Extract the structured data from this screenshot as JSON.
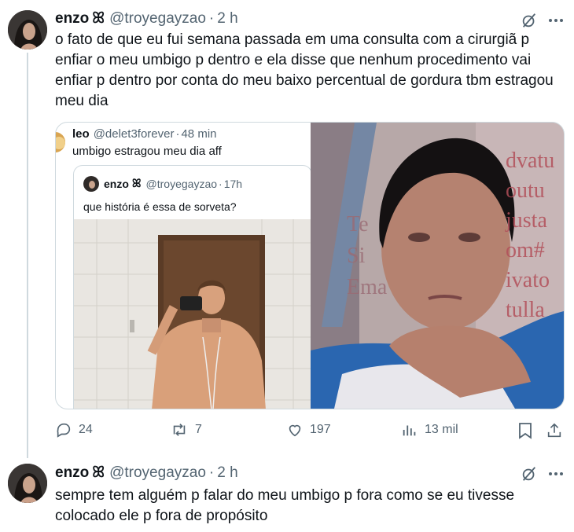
{
  "tweet1": {
    "display_name": "enzo",
    "badge": "ꕤ",
    "handle": "@troyegayzao",
    "sep": "·",
    "time": "2 h",
    "text_lines": [
      "o fato de que eu fui semana passada em uma consulta com a cirurgiã p",
      "enfiar o meu umbigo p dentro e ela disse que nenhum procedimento vai",
      "enfiar p dentro por conta do meu baixo percentual de gordura tbm estragou",
      "meu dia"
    ],
    "quote": {
      "display_name": "leo",
      "handle": "@delet3forever",
      "sep": "·",
      "time": "48 min",
      "text": "umbigo estragou meu dia aff",
      "inner": {
        "display_name": "enzo",
        "badge": "ꕤ",
        "handle": "@troyegayzao",
        "sep": "·",
        "time": "17h",
        "text": "que história é essa de sorveta?"
      },
      "photo_text_lines": [
        "dvatu",
        "outu",
        "justa",
        "om#",
        "ivato",
        "tulla"
      ],
      "photo_text_left": [
        "Te",
        "Si",
        "Ema"
      ]
    },
    "actions": {
      "replies": "24",
      "reposts": "7",
      "likes": "197",
      "views": "13 mil"
    }
  },
  "tweet2": {
    "display_name": "enzo",
    "badge": "ꕤ",
    "handle": "@troyegayzao",
    "sep": "·",
    "time": "2 h",
    "text_lines": [
      "sempre tem alguém p falar do meu umbigo p fora como se eu tivesse",
      "colocado ele p fora de propósito"
    ]
  },
  "icons": [
    "grok-icon",
    "more-icon",
    "reply-icon",
    "repost-icon",
    "like-icon",
    "views-icon",
    "bookmark-icon",
    "share-icon"
  ],
  "colors": {
    "text": "#0f1419",
    "secondary": "#536471",
    "border": "#cfd9de"
  }
}
